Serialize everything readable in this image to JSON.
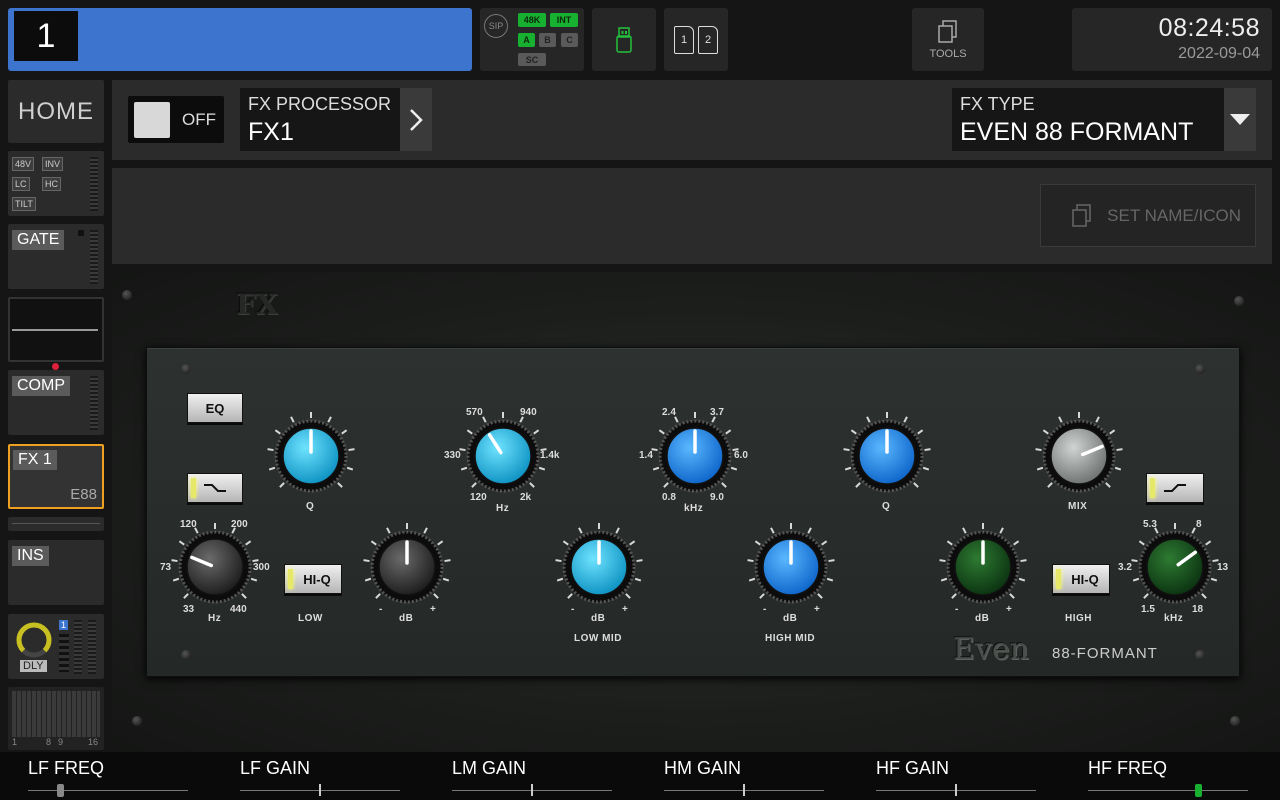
{
  "topbar": {
    "channel_number": "1",
    "status": {
      "sip": "SIP",
      "rate": "48K",
      "clock": "INT",
      "a": "A",
      "b": "B",
      "c": "C",
      "sc": "SC"
    },
    "cards": [
      "1",
      "2"
    ],
    "tools_label": "TOOLS",
    "time": "08:24:58",
    "date": "2022-09-04"
  },
  "sidebar": {
    "home": "HOME",
    "preamp_tags": [
      "48V",
      "INV",
      "LC",
      "HC",
      "TILT"
    ],
    "gate": "GATE",
    "comp": "COMP",
    "fx_slot": "FX 1",
    "fx_slot_sub": "E88",
    "ins": "INS",
    "dly": "DLY",
    "dly_badge": "1",
    "meter_range_a": "1",
    "meter_range_b": "8",
    "meter_range_c": "9",
    "meter_range_d": "16"
  },
  "header": {
    "onoff_label": "OFF",
    "fx_processor_title": "FX PROCESSOR",
    "fx_processor_value": "FX1",
    "fx_type_title": "FX TYPE",
    "fx_type_value": "EVEN 88 FORMANT",
    "set_name_label": "SET NAME/ICON"
  },
  "plugin": {
    "logo": "FX",
    "brand": "Even",
    "brand_sub": "88-FORMANT",
    "buttons": {
      "eq": "EQ",
      "hiq_low": "HI-Q",
      "hiq_high": "HI-Q"
    },
    "labels": {
      "q1": "Q",
      "hz1": "Hz",
      "khz1": "kHz",
      "q2": "Q",
      "mix": "MIX",
      "hz_low": "Hz",
      "low": "LOW",
      "db1": "dB",
      "db_lowmid": "dB",
      "lowmid": "LOW MID",
      "db_himid": "dB",
      "himid": "HIGH MID",
      "db_high": "dB",
      "high": "HIGH",
      "khz_high": "kHz"
    },
    "ticks": {
      "lmf": [
        "570",
        "940",
        "330",
        "1.4k",
        "120",
        "2k"
      ],
      "hmf": [
        "2.4",
        "3.7",
        "1.4",
        "6.0",
        "0.8",
        "9.0"
      ],
      "lf": [
        "120",
        "200",
        "73",
        "300",
        "33",
        "440"
      ],
      "hf": [
        "5.3",
        "8",
        "3.2",
        "13",
        "1.5",
        "18"
      ],
      "minus": "-",
      "plus": "+"
    },
    "knob_values": {
      "q_low": 0.5,
      "lmf_freq": 0.38,
      "hmf_freq": 0.5,
      "q_high": 0.5,
      "mix": 0.75,
      "lf_freq": 0.25,
      "lf_gain": 0.5,
      "lm_gain": 0.5,
      "hm_gain": 0.5,
      "hf_gain": 0.5,
      "hf_freq": 0.7
    }
  },
  "params": [
    {
      "label": "LF FREQ",
      "value": 0.2
    },
    {
      "label": "LF GAIN",
      "value": 0.5
    },
    {
      "label": "LM GAIN",
      "value": 0.5
    },
    {
      "label": "HM GAIN",
      "value": 0.5
    },
    {
      "label": "HF GAIN",
      "value": 0.5
    },
    {
      "label": "HF FREQ",
      "value": 0.69
    }
  ],
  "colors": {
    "accent": "#3d74cd",
    "active_green": "#18b030",
    "fx_slot_border": "#f0a020"
  }
}
